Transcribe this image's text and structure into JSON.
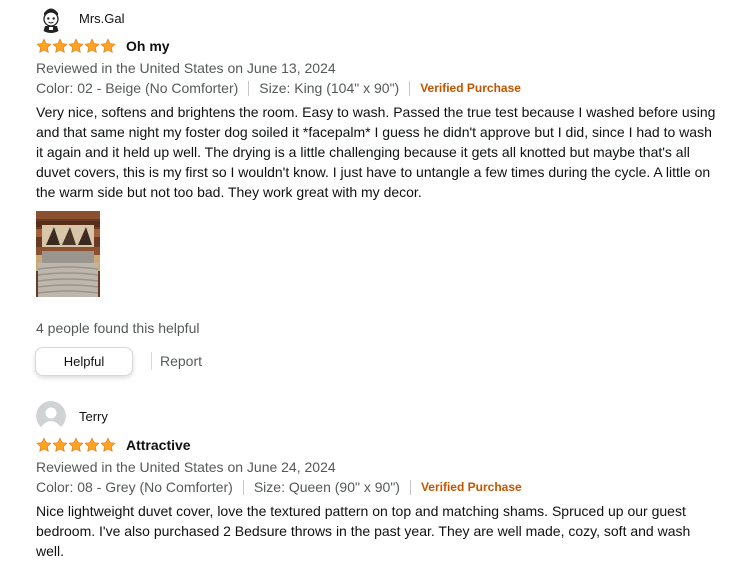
{
  "reviews": [
    {
      "user": "Mrs.Gal",
      "avatar_icon": "cartoon-character-avatar-icon",
      "rating": 5,
      "title": "Oh my",
      "date_line": "Reviewed in the United States on June 13, 2024",
      "color": "Color: 02 - Beige (No Comforter)",
      "size": "Size: King (104\" x 90\")",
      "verified": "Verified Purchase",
      "body": "Very nice, softens and brightens the room. Easy to wash. Passed the true test because I washed before using and that same night my foster dog soiled it *facepalm* I guess he didn't approve but I did, since I had to wash it again and it held up well. The drying is a little challenging because it gets all knotted but maybe that's all duvet covers, this is my first so I wouldn't know. I just have to untangle a few times during the cycle. A little on the warm side but not too bad. They work great with my decor.",
      "helpful_count": "4 people found this helpful",
      "helpful_label": "Helpful",
      "report_label": "Report"
    },
    {
      "user": "Terry",
      "avatar_icon": "default-user-avatar-icon",
      "rating": 5,
      "title": "Attractive",
      "date_line": "Reviewed in the United States on June 24, 2024",
      "color": "Color: 08 - Grey (No Comforter)",
      "size": "Size: Queen (90\" x 90\")",
      "verified": "Verified Purchase",
      "body": "Nice lightweight duvet cover, love the textured pattern on top and matching shams. Spruced up our guest bedroom. I've also purchased 2 Bedsure throws in the past year. They are well made, cozy, soft and wash well."
    }
  ],
  "colors": {
    "star": "#ffa41c",
    "star_outline": "#de7921",
    "verified": "#c45500",
    "muted": "#565959"
  }
}
